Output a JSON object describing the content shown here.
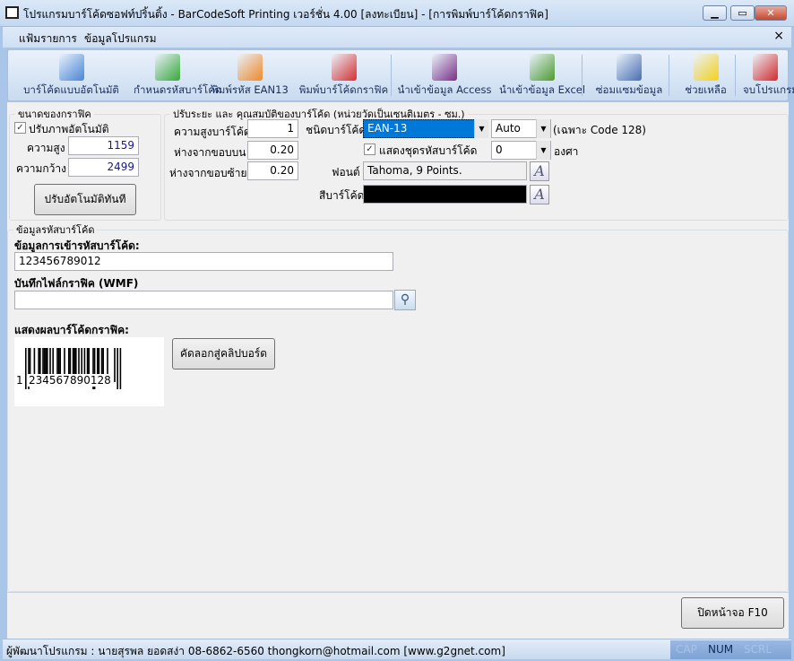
{
  "window": {
    "title": "โปรแกรมบาร์โค้ดซอฟท์ปริ้นติ้ง - BarCodeSoft Printing เวอร์ชั่น 4.00 [ลงทะเบียน] - [การพิมพ์บาร์โค้ดกราฟิค]",
    "minimize": "▁",
    "maximize": "▭",
    "close": "✕",
    "mdi_close": "×"
  },
  "menu": [
    "แฟ้มรายการ",
    "ข้อมูลโปรแกรม"
  ],
  "toolbar": [
    {
      "label": "บาร์โค้ดแบบอัตโนมัติ",
      "icon": "blue-folder-icon",
      "color": "#4a86d6"
    },
    {
      "label": "กำหนดรหัสบาร์โค้ด",
      "icon": "green-folder-icon",
      "color": "#3aa83a"
    },
    {
      "label": "พิมพ์รหัส EAN13",
      "icon": "orange-folder-icon",
      "color": "#f08a2a"
    },
    {
      "label": "พิมพ์บาร์โค้ดกราฟิค",
      "icon": "red-folder-icon",
      "color": "#d63030"
    },
    {
      "label": "นำเข้าข้อมูล Access",
      "icon": "mdb-file-icon",
      "color": "#7a2f86"
    },
    {
      "label": "นำเข้าข้อมูล Excel",
      "icon": "xls-file-icon",
      "color": "#4f9b2f"
    },
    {
      "label": "ซ่อมแซมข้อมูล",
      "icon": "repair-monitor-icon",
      "color": "#4a6fb0"
    },
    {
      "label": "ช่วยเหลือ",
      "icon": "lightbulb-icon",
      "color": "#f5d21a"
    },
    {
      "label": "จบโปรแกรม",
      "icon": "power-icon",
      "color": "#d42a2a"
    }
  ],
  "graphic_size": {
    "legend": "ขนาดของกราฟิค",
    "auto_label": "ปรับภาพอัตโนมัติ",
    "auto_checked": true,
    "height_label": "ความสูง",
    "height": "1159",
    "width_label": "ความกว้าง",
    "width": "2499",
    "auto_button": "ปรับอัตโนมัติทันที"
  },
  "barcode_props": {
    "legend": "ปรับระยะ และ คุณสมบัติของบาร์โค้ด (หน่วยวัดเป็นเซนติเมตร - ซม.)",
    "bar_height_label": "ความสูงบาร์โค้ด",
    "bar_height": "1",
    "top_margin_label": "ห่างจากขอบบน",
    "top_margin": "0.20",
    "left_margin_label": "ห่างจากขอบซ้าย",
    "left_margin": "0.20",
    "type_label": "ชนิดบาร์โค้ด",
    "type": "EAN-13",
    "subset": "Auto",
    "subset_note": "(เฉพาะ Code 128)",
    "show_code_label": "แสดงชุดรหัสบาร์โค้ด",
    "show_code_checked": true,
    "angle": "0",
    "angle_unit": "องศา",
    "font_label": "ฟอนต์",
    "font": "Tahoma, 9 Points.",
    "color_label": "สีบาร์โค้ด",
    "bar_color": "#000000"
  },
  "barcode_data": {
    "legend": "ข้อมูลรหัสบาร์โค้ด",
    "input_label": "ข้อมูลการเข้ารหัสบาร์โค้ด:",
    "input_value": "123456789012",
    "wmf_label": "บันทึกไฟล์กราฟิค (WMF)",
    "wmf_value": "",
    "preview_label": "แสดงผลบาร์โค้ดกราฟิค:",
    "human_readable": [
      "1",
      "234567",
      "890128"
    ],
    "copy_button": "คัดลอกสู่คลิปบอร์ด"
  },
  "close_button": "ปิดหน้าจอ F10",
  "status": {
    "text": "ผู้พัฒนาโปรแกรม : นายสุรพล ยอดสง่า 08-6862-6560 thongkorn@hotmail.com [www.g2gnet.com]",
    "cap": "CAP",
    "num": "NUM",
    "scrl": "SCRL"
  }
}
